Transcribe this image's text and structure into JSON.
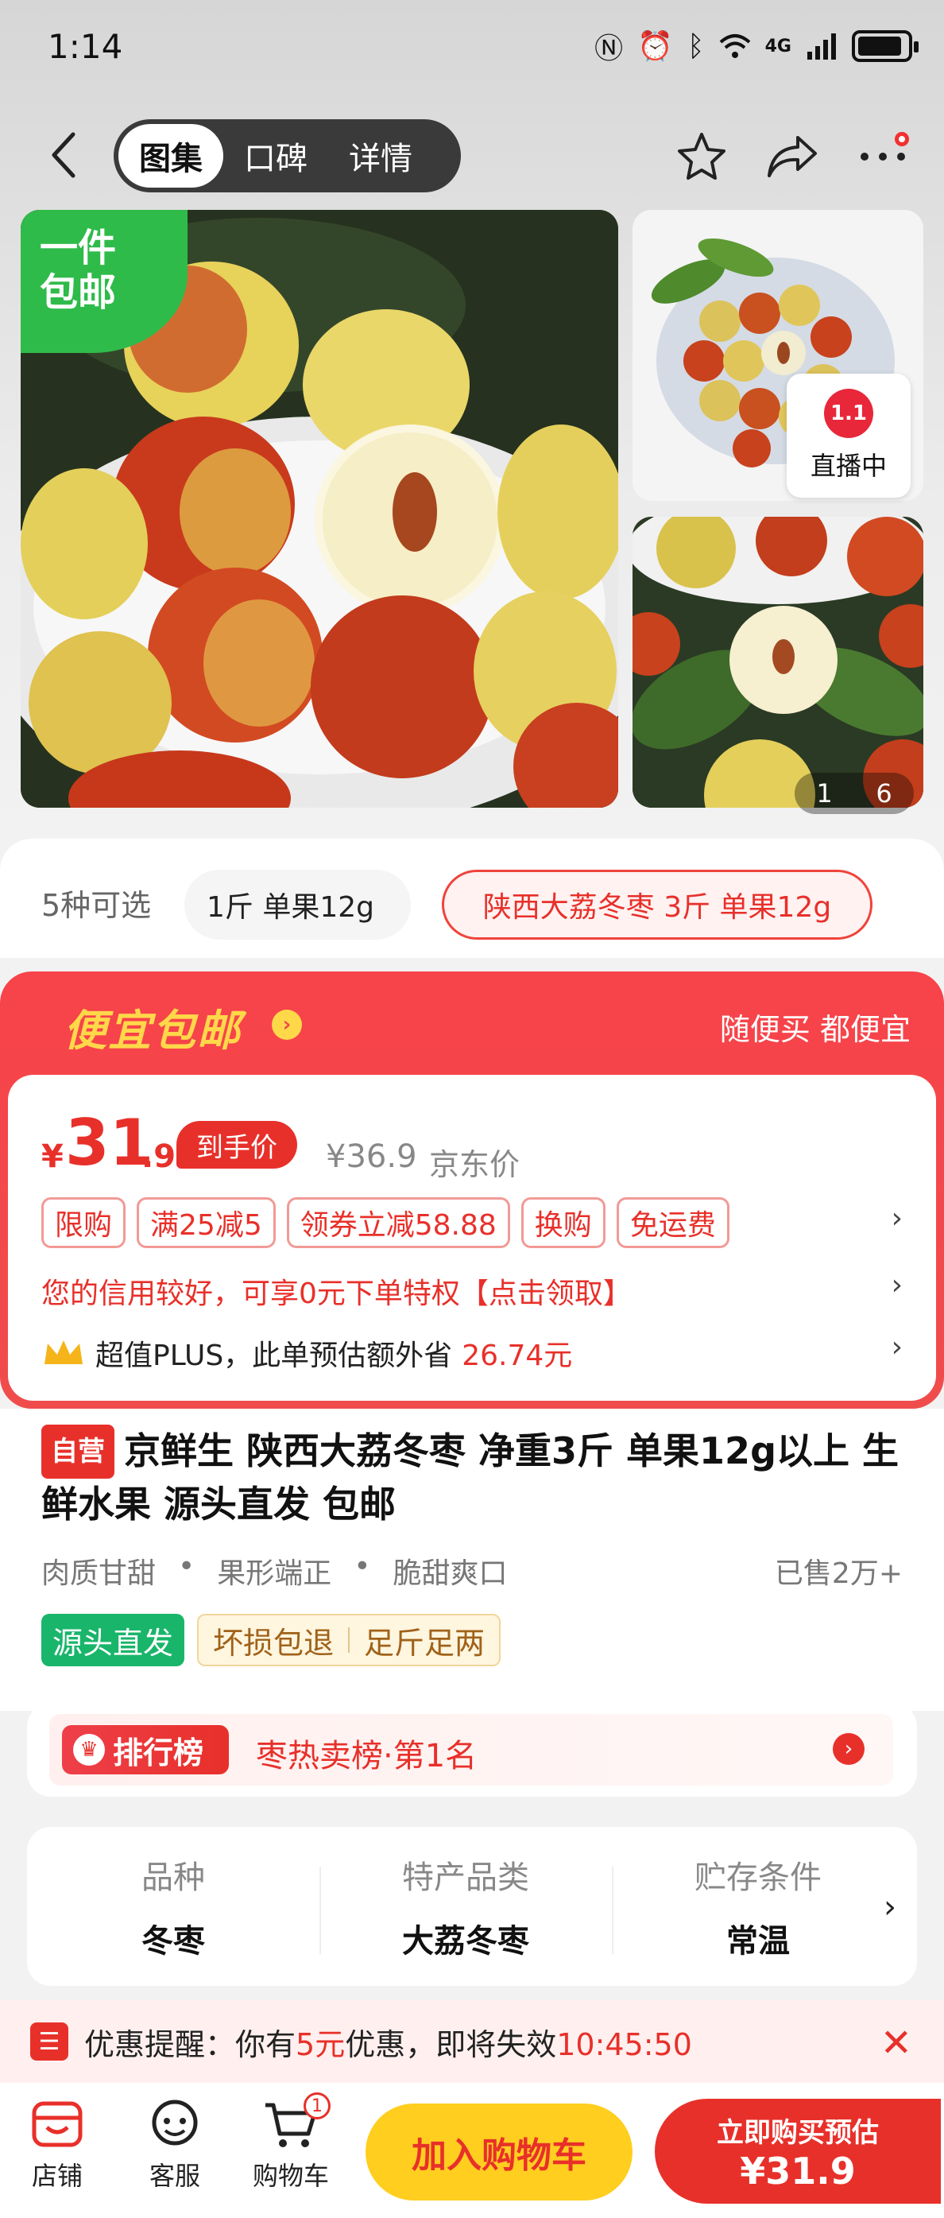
{
  "status_bar": {
    "time": "1:14",
    "network": "4G"
  },
  "nav": {
    "tabs": [
      {
        "label": "图集",
        "active": true
      },
      {
        "label": "口碑",
        "active": false
      },
      {
        "label": "详情",
        "active": false
      }
    ]
  },
  "gallery": {
    "ship_badge_line1": "一件",
    "ship_badge_line2": "包邮",
    "live_label": "直播中",
    "live_icon_text": "1.1",
    "page_current": "1",
    "page_total": "6"
  },
  "variants": {
    "count_label": "5种可选",
    "options": [
      {
        "label": "1斤 单果12g",
        "selected": false
      },
      {
        "label": "陕西大荔冬枣 3斤 单果12g",
        "selected": true
      }
    ]
  },
  "promo": {
    "title": "便宜包邮",
    "slogan": "随便买 都便宜",
    "price_symbol": "¥",
    "price_int": "31",
    "price_dec": ".9",
    "price_tag": "到手价",
    "original_price": "¥36.9",
    "original_label": "京东价",
    "coupons": [
      "限购",
      "满25减5",
      "领券立减58.88",
      "换购",
      "免运费"
    ],
    "credit_text": "您的信用较好，可享0元下单特权【点击领取】",
    "plus_text": "超值PLUS，此单预估额外省",
    "plus_amount": "26.74元"
  },
  "product": {
    "self_tag": "自营",
    "title": "京鲜生 陕西大荔冬枣 净重3斤 单果12g以上 生鲜水果 源头直发 包邮",
    "attributes": [
      "肉质甘甜",
      "果形端正",
      "脆甜爽口"
    ],
    "sold": "已售2万+",
    "tag_green": "源头直发",
    "tag_yellow": [
      "坏损包退",
      "足斤足两"
    ]
  },
  "ranking": {
    "badge": "排行榜",
    "text": "枣热卖榜·第1名"
  },
  "specs": [
    {
      "label": "品种",
      "value": "冬枣"
    },
    {
      "label": "特产品类",
      "value": "大荔冬枣"
    },
    {
      "label": "贮存条件",
      "value": "常温"
    }
  ],
  "reminder": {
    "prefix": "优惠提醒：你有",
    "amount": "5元",
    "middle": "优惠，即将失效",
    "countdown": "10:45:50"
  },
  "bottom_bar": {
    "shop_label": "店铺",
    "service_label": "客服",
    "cart_label": "购物车",
    "cart_count": "1",
    "add_to_cart": "加入购物车",
    "buy_now": "立即购买预估",
    "buy_price": "¥31.9"
  },
  "colors": {
    "accent_red": "#e8302a",
    "promo_yellow": "#ffd84a",
    "cart_button": "#ffce1f",
    "badge_green": "#2fbb4a"
  }
}
